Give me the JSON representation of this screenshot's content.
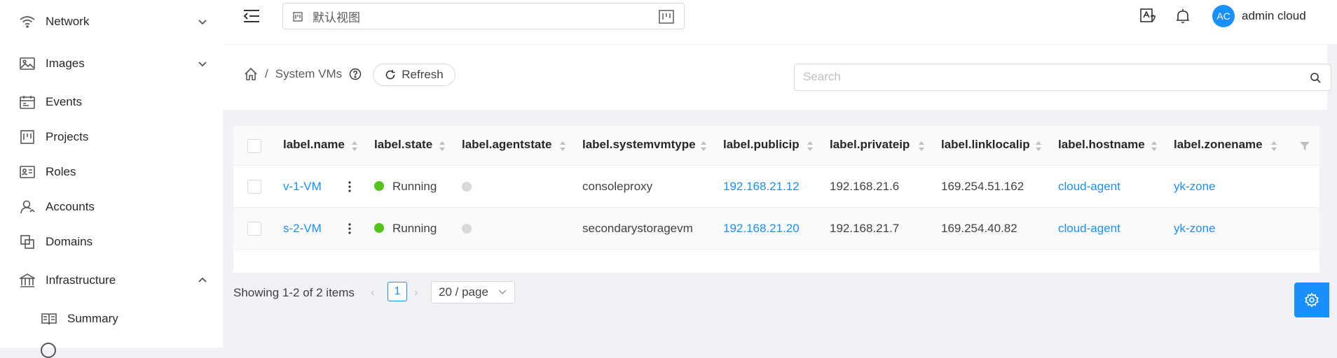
{
  "sidebar": {
    "items": [
      {
        "label": "Network",
        "icon": "wifi-icon"
      },
      {
        "label": "Images",
        "icon": "image-icon"
      },
      {
        "label": "Events",
        "icon": "calendar-icon"
      },
      {
        "label": "Projects",
        "icon": "project-icon"
      },
      {
        "label": "Roles",
        "icon": "idcard-icon"
      },
      {
        "label": "Accounts",
        "icon": "user-icon"
      },
      {
        "label": "Domains",
        "icon": "block-icon"
      },
      {
        "label": "Infrastructure",
        "icon": "bank-icon"
      },
      {
        "label": "Summary",
        "icon": "read-icon"
      }
    ]
  },
  "header": {
    "view_label": "默认视图",
    "username": "admin cloud",
    "avatar_initials": "AC"
  },
  "page": {
    "breadcrumb_current": "System VMs",
    "refresh_label": "Refresh",
    "search_placeholder": "Search"
  },
  "table": {
    "columns": [
      "label.name",
      "label.state",
      "label.agentstate",
      "label.systemvmtype",
      "label.publicip",
      "label.privateip",
      "label.linklocalip",
      "label.hostname",
      "label.zonename"
    ],
    "rows": [
      {
        "name": "v-1-VM",
        "state": "Running",
        "agentstate": "",
        "systemvmtype": "consoleproxy",
        "publicip": "192.168.21.12",
        "privateip": "192.168.21.6",
        "linklocalip": "169.254.51.162",
        "hostname": "cloud-agent",
        "zonename": "yk-zone"
      },
      {
        "name": "s-2-VM",
        "state": "Running",
        "agentstate": "",
        "systemvmtype": "secondarystoragevm",
        "publicip": "192.168.21.20",
        "privateip": "192.168.21.7",
        "linklocalip": "169.254.40.82",
        "hostname": "cloud-agent",
        "zonename": "yk-zone"
      }
    ]
  },
  "pagination": {
    "total_text": "Showing 1-2 of 2 items",
    "current_page": "1",
    "page_size": "20 / page"
  },
  "colors": {
    "accent": "#1890ff",
    "running": "#52c41a",
    "agent_unknown": "#d9d9d9"
  }
}
